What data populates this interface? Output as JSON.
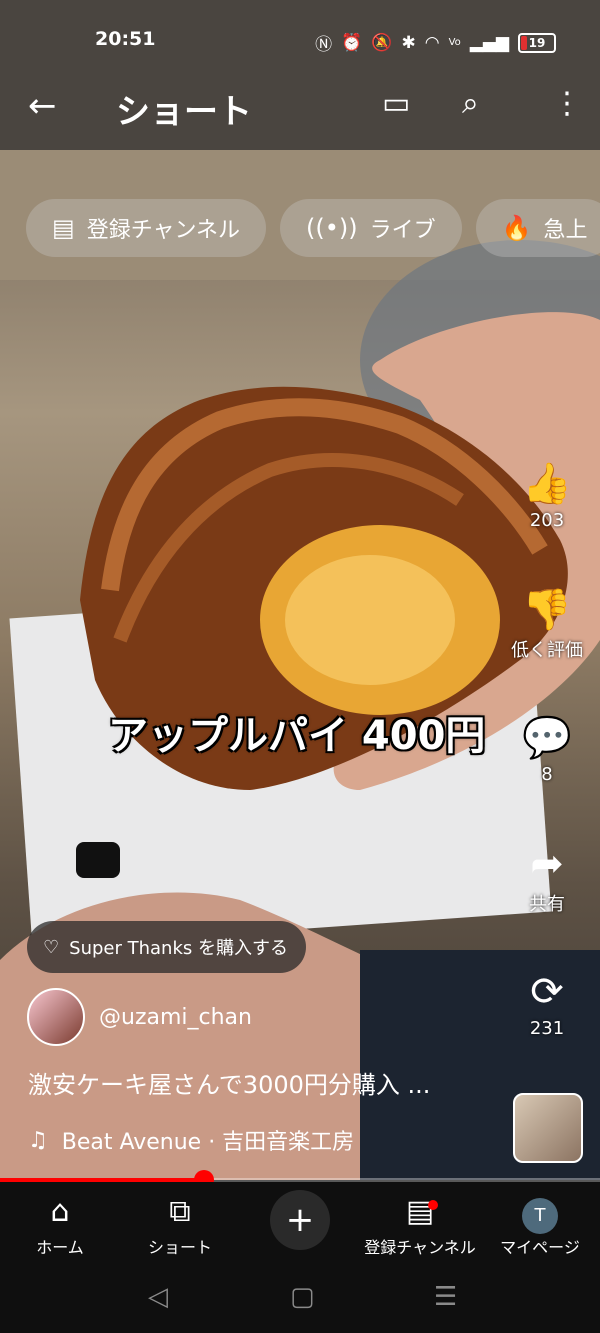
{
  "status_bar": {
    "time": "20:51",
    "battery": "19",
    "icons": [
      "nfc-icon",
      "alarm-icon",
      "mute-icon",
      "bluetooth-icon",
      "wifi-icon",
      "volte-icon",
      "signal-icon"
    ]
  },
  "header": {
    "title": "ショート",
    "icons": [
      "back-arrow-icon",
      "cast-icon",
      "search-icon",
      "more-vert-icon"
    ]
  },
  "chips": [
    {
      "label": "登録チャンネル",
      "icon": "subscriptions-icon"
    },
    {
      "label": "ライブ",
      "icon": "live-icon"
    },
    {
      "label": "急上",
      "icon": "trending-icon"
    }
  ],
  "video": {
    "overlay_caption": "アップルパイ 400円"
  },
  "actions": {
    "like_count": "203",
    "dislike_label": "低く評価",
    "comment_count": "8",
    "share_label": "共有",
    "remix_count": "231"
  },
  "super_thanks": {
    "label": "Super Thanks を購入する"
  },
  "channel": {
    "handle": "@uzami_chan"
  },
  "description": "激安ケーキ屋さんで3000円分購入 ...",
  "music": {
    "label": "Beat Avenue · 吉田音楽工房"
  },
  "progress": {
    "fraction": 0.34
  },
  "bottom_nav": {
    "home": "ホーム",
    "shorts": "ショート",
    "subscriptions": "登録チャンネル",
    "mypage": "マイページ",
    "avatar_letter": "T"
  },
  "colors": {
    "accent": "#ff0000",
    "nav_bg": "#0f0f0f"
  }
}
